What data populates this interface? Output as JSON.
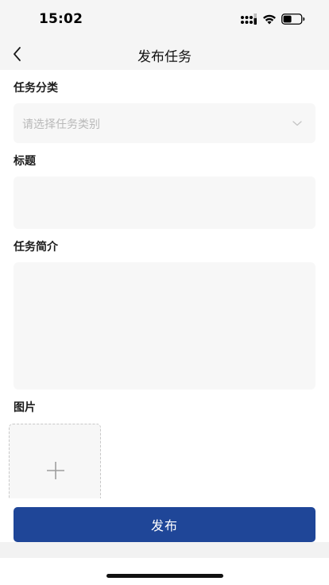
{
  "status_bar": {
    "time": "15:02",
    "icons": [
      "cellular-signal-icon",
      "wifi-icon",
      "battery-icon"
    ]
  },
  "nav": {
    "title": "发布任务",
    "back_icon": "chevron-left-icon"
  },
  "form": {
    "category": {
      "label": "任务分类",
      "placeholder": "请选择任务类别",
      "icon": "chevron-down-icon"
    },
    "title": {
      "label": "标题",
      "value": ""
    },
    "description": {
      "label": "任务简介",
      "value": ""
    },
    "images": {
      "label": "图片",
      "icon": "plus-icon"
    }
  },
  "submit": {
    "label": "发布"
  },
  "colors": {
    "primary": "#1f4698",
    "header_bg": "#f5f5f5",
    "input_bg": "#f7f7f7",
    "placeholder": "#b9b9b9"
  }
}
